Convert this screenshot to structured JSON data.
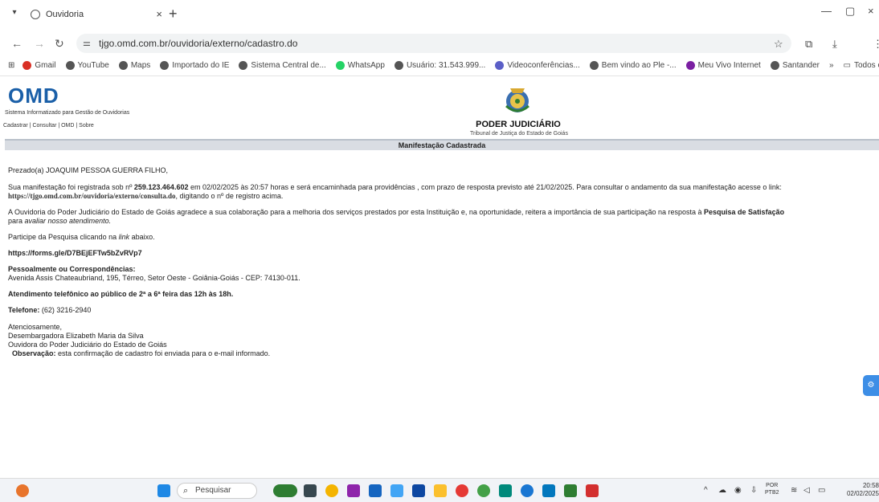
{
  "browser": {
    "tab_title": "Ouvidoria",
    "url": "tjgo.omd.com.br/ouvidoria/externo/cadastro.do",
    "bookmarks": [
      {
        "label": "Gmail",
        "color": "#d93025"
      },
      {
        "label": "YouTube",
        "color": "#555555"
      },
      {
        "label": "Maps",
        "color": "#555555"
      },
      {
        "label": "Importado do IE",
        "color": "#555555"
      },
      {
        "label": "Sistema Central de...",
        "color": "#555555"
      },
      {
        "label": "WhatsApp",
        "color": "#25d366"
      },
      {
        "label": "Usuário: 31.543.999...",
        "color": "#555555"
      },
      {
        "label": "Videoconferências...",
        "color": "#5b5fc7"
      },
      {
        "label": "Bem vindo ao Ple -...",
        "color": "#555555"
      },
      {
        "label": "Meu Vivo Internet",
        "color": "#7b1fa2"
      },
      {
        "label": "Santander",
        "color": "#555555"
      }
    ],
    "more_bookmarks": "»",
    "all_favorites": "Todos os favoritos"
  },
  "header": {
    "logo": "OMD",
    "subtitle": "Sistema Informatizado para Gestão de Ouvidorias",
    "nav": "Cadastrar  |  Consultar  |  OMD  |  Sobre",
    "court_title": "PODER JUDICIÁRIO",
    "court_sub": "Tribunal de Justiça do Estado de Goiás",
    "bar_title": "Manifestação Cadastrada"
  },
  "message": {
    "greeting": "Prezado(a) JOAQUIM PESSOA GUERRA FILHO,",
    "reg_prefix": "Sua manifestação foi registrada sob nº ",
    "reg_number": "259.123.464.602",
    "reg_text": " em 02/02/2025 às 20:57 horas e será encaminhada para providências , com prazo de resposta previsto até 21/02/2025. Para consultar o andamento da sua manifestação acesse o link:",
    "consult_link": "https://tjgo.omd.com.br/ouvidoria/externo/consulta.do",
    "consult_suffix": ", digitando o nº de registro acima.",
    "thanks_text": "A Ouvidoria do Poder Judiciário do Estado de Goiás agradece a sua colaboração para a melhoria dos serviços prestados por esta Instituição e, na oportunidade, reitera a importância de sua participação na resposta à ",
    "thanks_bold": "Pesquisa de Satisfação",
    "thanks_line2_prefix": "para ",
    "thanks_line2_italic": "avaliar nosso atendimento.",
    "participate_prefix": "Participe da Pesquisa clicando na ",
    "participate_italic": "link",
    "participate_suffix": " abaixo.",
    "survey_link": "https://forms.gle/D7BEjEFTw5bZvRVp7",
    "in_person_label": "Pessoalmente ou Correspondências:",
    "address": "Avenida Assis Chateaubriand, 195, Térreo, Setor Oeste - Goiânia-Goiás - CEP: 74130-011.",
    "phone_service": "Atendimento telefônico ao público de 2ª a 6ª feira das 12h às 18h.",
    "phone_label": "Telefone:",
    "phone": " (62) 3216-2940",
    "closing": "Atenciosamente,",
    "signer": "Desembargadora Elizabeth Maria da Silva",
    "signer_role": "Ouvidora do Poder Judiciário do Estado de Goiás",
    "obs_label": "Observação:",
    "obs_text": " esta confirmação de cadastro foi enviada para o e-mail informado."
  },
  "taskbar": {
    "search_placeholder": "Pesquisar",
    "lang_top": "POR",
    "lang_bottom": "PTB2",
    "time": "20:58",
    "date": "02/02/2025"
  }
}
